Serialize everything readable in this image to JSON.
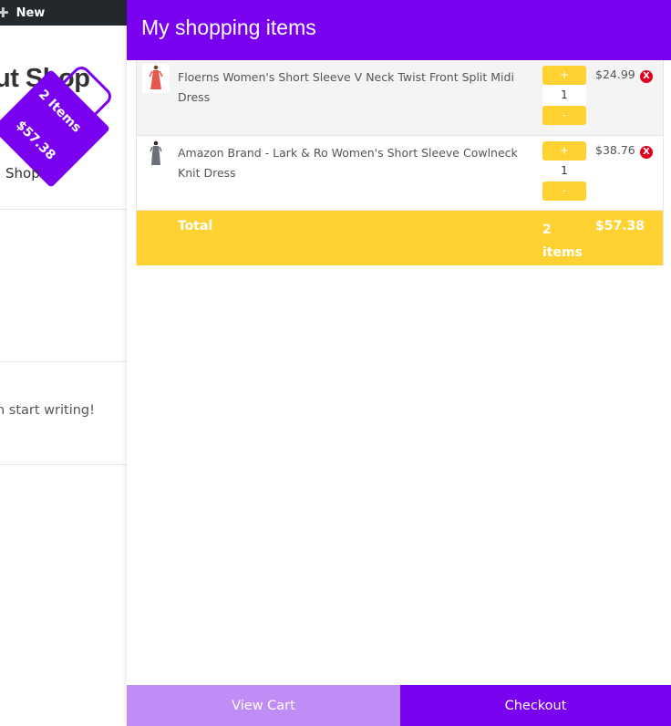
{
  "admin_bar": {
    "new_label": "New"
  },
  "background_page": {
    "site_title": "ut Shop",
    "shop_link": "Shop",
    "body_text": "n start writing!",
    "cart_badge": {
      "items": "2 Items",
      "price": "$57.38"
    }
  },
  "drawer": {
    "title": "My shopping items",
    "items": [
      {
        "name": "Floerns Women's Short Sleeve V Neck Twist Front Split Midi Dress",
        "quantity": "1",
        "price": "$24.99",
        "image_color": "#e8574d"
      },
      {
        "name": "Amazon Brand - Lark & Ro Women's Short Sleeve Cowlneck Knit Dress",
        "quantity": "1",
        "price": "$38.76",
        "image_color": "#6b6f78"
      }
    ],
    "qty_plus": "+",
    "qty_minus": "-",
    "remove_label": "X",
    "total": {
      "label": "Total",
      "items": "2 items",
      "price": "$57.38"
    },
    "footer": {
      "view_cart": "View Cart",
      "checkout": "Checkout"
    }
  },
  "colors": {
    "accent": "#7a00f0",
    "accent_light": "#c08df7",
    "highlight": "#ffd232",
    "remove": "#e0001b"
  }
}
